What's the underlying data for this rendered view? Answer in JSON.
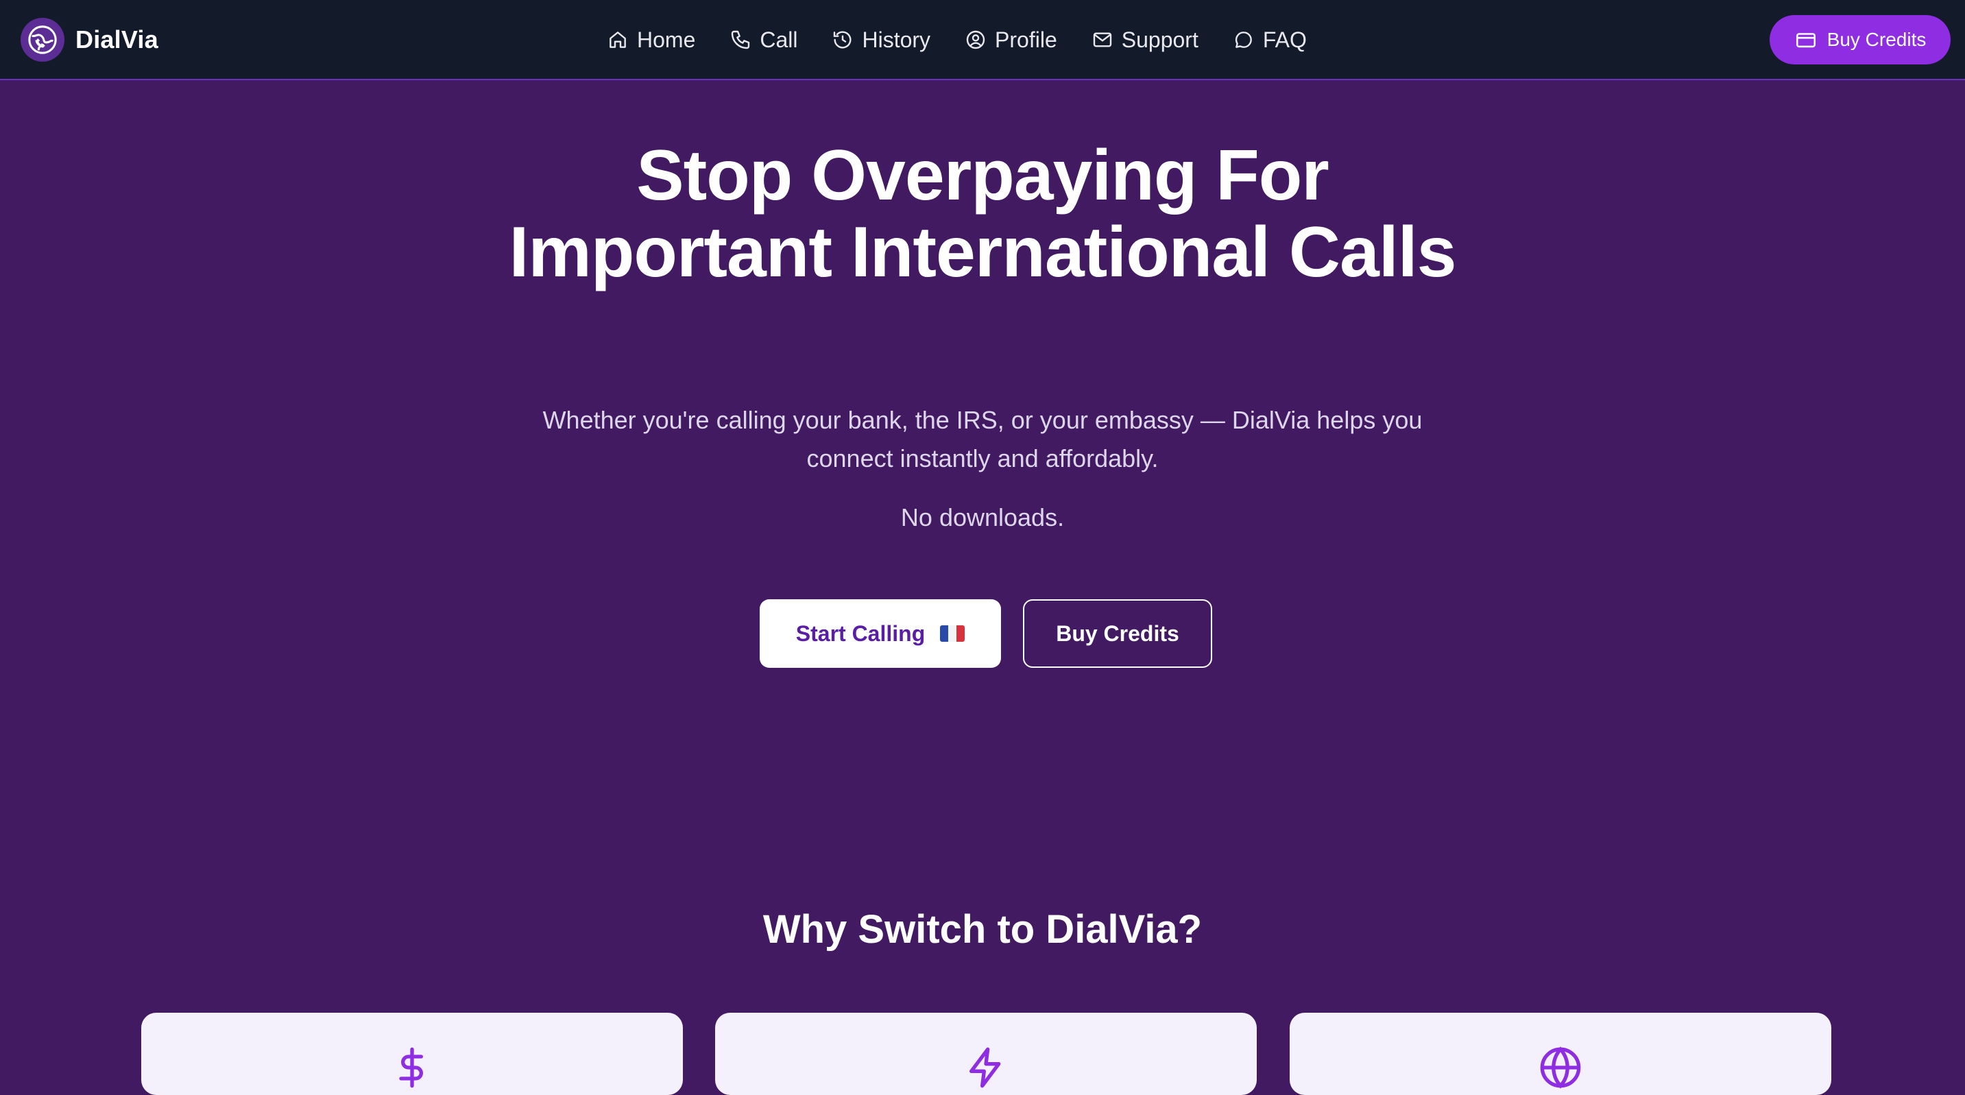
{
  "app": {
    "name": "DialVia",
    "logo_icon": "globe-phone-icon"
  },
  "nav": {
    "items": [
      {
        "label": "Home",
        "icon": "home-icon"
      },
      {
        "label": "Call",
        "icon": "phone-icon"
      },
      {
        "label": "History",
        "icon": "history-icon"
      },
      {
        "label": "Profile",
        "icon": "user-circle-icon"
      },
      {
        "label": "Support",
        "icon": "mail-icon"
      },
      {
        "label": "FAQ",
        "icon": "chat-bubble-icon"
      }
    ],
    "buy_credits_label": "Buy Credits",
    "buy_credits_icon": "credit-card-icon"
  },
  "hero": {
    "title": "Stop Overpaying For Important International Calls",
    "subtitle": "Whether you're calling your bank, the IRS, or your embassy — DialVia helps you connect instantly and affordably.",
    "note": "No downloads.",
    "primary_button": "Start Calling",
    "primary_button_flag": "france-flag-icon",
    "secondary_button": "Buy Credits"
  },
  "why": {
    "title": "Why Switch to DialVia?",
    "cards": [
      {
        "icon": "dollar-icon"
      },
      {
        "icon": "lightning-icon"
      },
      {
        "icon": "globe-icon"
      }
    ]
  },
  "colors": {
    "background": "#411a62",
    "navbar": "#131b2a",
    "accent": "#8e2de2",
    "primary_text": "#5a1ea6"
  }
}
